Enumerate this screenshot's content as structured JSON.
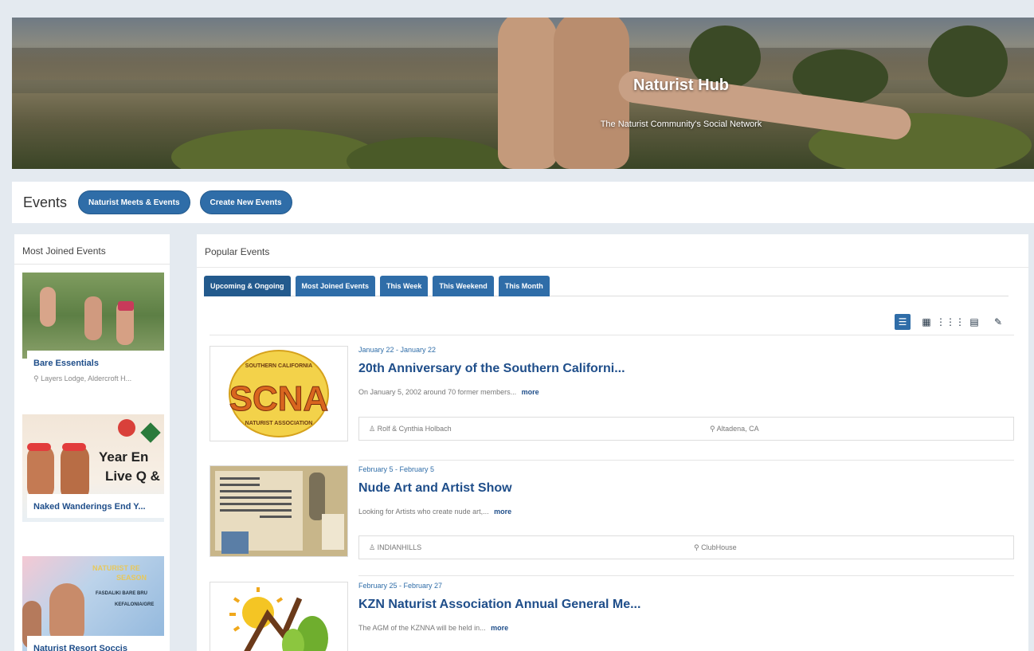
{
  "banner": {
    "title": "Naturist Hub",
    "subtitle": "The Naturist Community's Social Network"
  },
  "events_bar": {
    "title": "Events",
    "buttons": [
      "Naturist Meets & Events",
      "Create New Events"
    ]
  },
  "most_joined": {
    "heading": "Most Joined Events",
    "items": [
      {
        "name": "Bare Essentials",
        "location": "Layers Lodge, Aldercroft H..."
      },
      {
        "name": "Naked Wanderings End Y...",
        "location": "",
        "image_text": [
          "Year En",
          "Live Q &"
        ]
      },
      {
        "name": "Naturist Resort Soccis",
        "location": "",
        "image_text": [
          "NATURIST RE",
          "SEASON",
          "FASDALIKI BARE BRU",
          "KEFALONIA/GRE"
        ]
      }
    ]
  },
  "popular": {
    "heading": "Popular Events",
    "tabs": [
      "Upcoming & Ongoing",
      "Most Joined Events",
      "This Week",
      "This Weekend",
      "This Month"
    ],
    "active_tab": "Upcoming & Ongoing",
    "view_icons": [
      "list-view-icon",
      "grid-2-icon",
      "grid-3-icon",
      "calendar-view-icon",
      "map-pin-view-icon"
    ],
    "events": [
      {
        "date": "January 22 - January 22",
        "title": "20th Anniversary of the Southern Californi...",
        "desc": "On January 5, 2002 around 70 former members...",
        "more": "more",
        "organizer": "Rolf & Cynthia Holbach",
        "location": "Altadena, CA",
        "logo": {
          "top": "SOUTHERN CALIFORNIA",
          "main": "SCNA",
          "bottom": "NATURIST ASSOCIATION"
        }
      },
      {
        "date": "February 5 - February 5",
        "title": "Nude Art and Artist Show",
        "desc": "Looking for Artists who create nude art,...",
        "more": "more",
        "organizer": "INDIANHILLS",
        "location": "ClubHouse"
      },
      {
        "date": "February 25 - February 27",
        "title": "KZN Naturist Association Annual General Me...",
        "desc": "The AGM of the KZNNA will be held in...",
        "more": "more",
        "organizer": "",
        "location": ""
      }
    ]
  },
  "colors": {
    "primary": "#2f6da8",
    "title_blue": "#1f4e8a",
    "background": "#e4eaf0"
  }
}
